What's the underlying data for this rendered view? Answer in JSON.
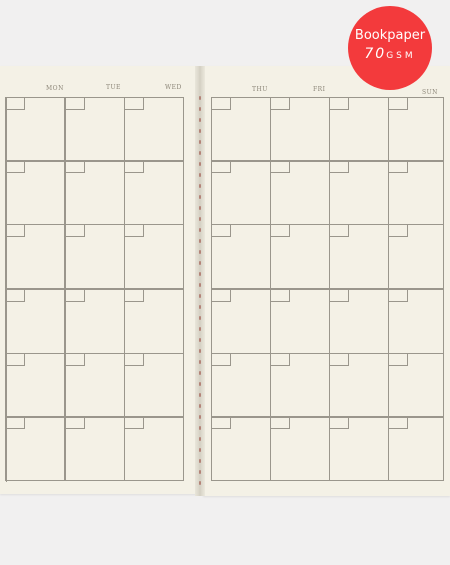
{
  "planner": {
    "left_page": {
      "days": [
        "MON",
        "TUE",
        "WED"
      ]
    },
    "right_page": {
      "days": [
        "THU",
        "FRI",
        "SUN"
      ]
    }
  },
  "badge": {
    "line1": "Bookpaper",
    "line2_number": "70",
    "line2_unit": "GSM",
    "color": "#f33a3c"
  },
  "colors": {
    "paper": "#f4f1e6",
    "grid_line": "#9a968c",
    "background": "#f1f0f0"
  }
}
